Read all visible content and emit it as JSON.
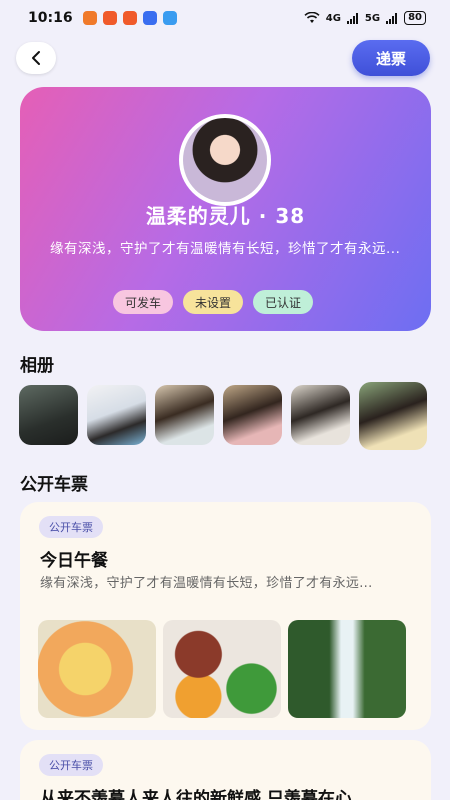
{
  "status_bar": {
    "time": "10:16",
    "net_4g": "4G",
    "net_5g": "5G",
    "battery": "80"
  },
  "header": {
    "send_ticket_label": "递票"
  },
  "profile": {
    "name": "温柔的灵儿 · 38",
    "bio": "缘有深浅，守护了才有温暖情有长短，珍惜了才有永远...",
    "tags": [
      "可发车",
      "未设置",
      "已认证"
    ]
  },
  "album": {
    "title": "相册"
  },
  "public_tickets": {
    "title": "公开车票",
    "posts": [
      {
        "badge": "公开车票",
        "title": "今日午餐",
        "text": "缘有深浅，守护了才有温暖情有长短，珍惜了才有永远..."
      },
      {
        "badge": "公开车票",
        "title": "从来不羡慕人来人往的新鲜感 只羡慕在心"
      }
    ]
  },
  "colors": {
    "accent": "#3f50d8",
    "card_gradient_start": "#e55fb6",
    "card_gradient_end": "#6d6ef2"
  }
}
